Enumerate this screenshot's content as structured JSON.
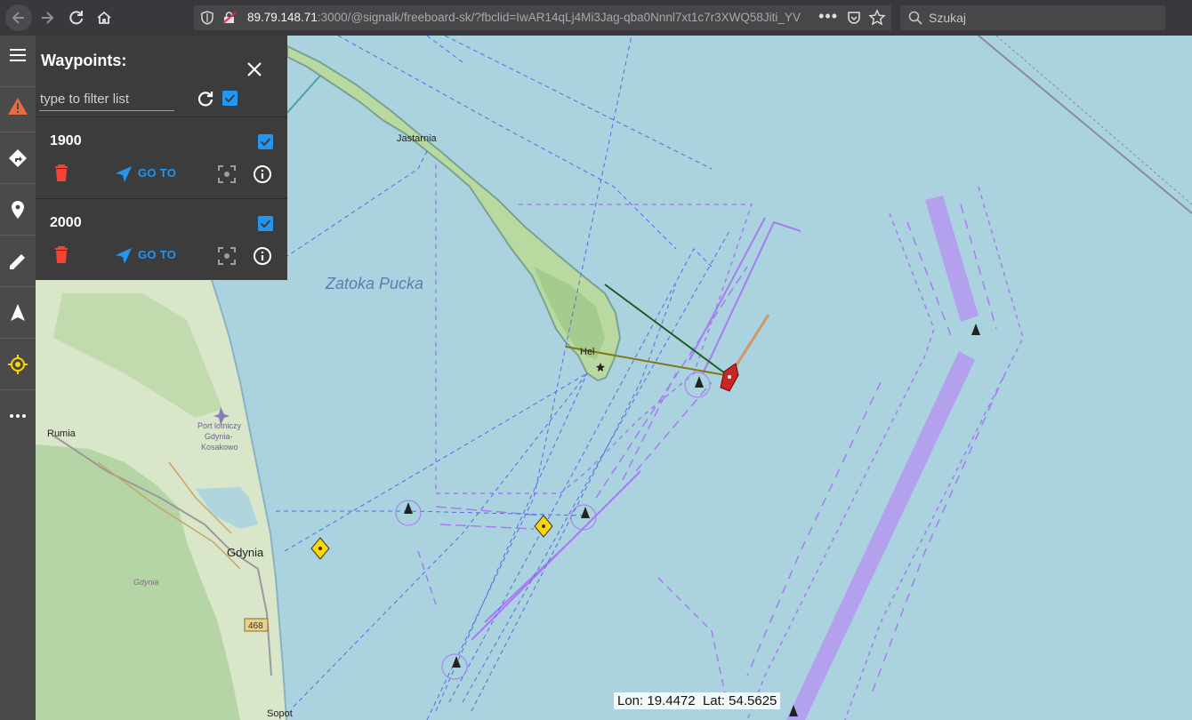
{
  "browser": {
    "url_host": "89.79.148.71",
    "url_rest": ":3000/@signalk/freeboard-sk/?fbclid=IwAR14qLj4Mi3Jag-qba0Nnnl7xt1c7r3XWQ58Jiti_YV",
    "more_label": "•••",
    "search_placeholder": "Szukaj"
  },
  "toolbar": {
    "items": [
      {
        "icon": "menu-icon"
      },
      {
        "icon": "alarm-icon",
        "color": "#e64a19"
      },
      {
        "icon": "routes-icon"
      },
      {
        "icon": "waypoint-icon"
      },
      {
        "icon": "edit-icon"
      },
      {
        "icon": "navigation-icon"
      },
      {
        "icon": "gps-fixed-icon",
        "color": "#ffd600"
      },
      {
        "icon": "more-icon"
      }
    ]
  },
  "waypoints_panel": {
    "title": "Waypoints:",
    "filter_placeholder": "type to filter list",
    "items": [
      {
        "name": "1900",
        "selected": true,
        "goto_label": "GO TO"
      },
      {
        "name": "2000",
        "selected": true,
        "goto_label": "GO TO"
      }
    ]
  },
  "map": {
    "labels": {
      "jastarnia": "Jastarnia",
      "zatoka": "Zatoka Pucka",
      "hel": "Hel",
      "rumia": "Rumia",
      "airport_1": "Port lotniczy",
      "airport_2": "Gdynia-",
      "airport_3": "Kosakowo",
      "gdynia": "Gdynia",
      "gdynia_small": "Gdynia",
      "road": "468",
      "sopot": "Sopot"
    },
    "coords": {
      "lon_label": "Lon:",
      "lon": "19.4472",
      "lat_label": "Lat:",
      "lat": "54.5625"
    },
    "colors": {
      "sea": "#aad3df",
      "land": "#b9d9a0",
      "vessel": "#c62828",
      "waypoint": "#ffd600",
      "tss": "#a67cf0"
    }
  }
}
